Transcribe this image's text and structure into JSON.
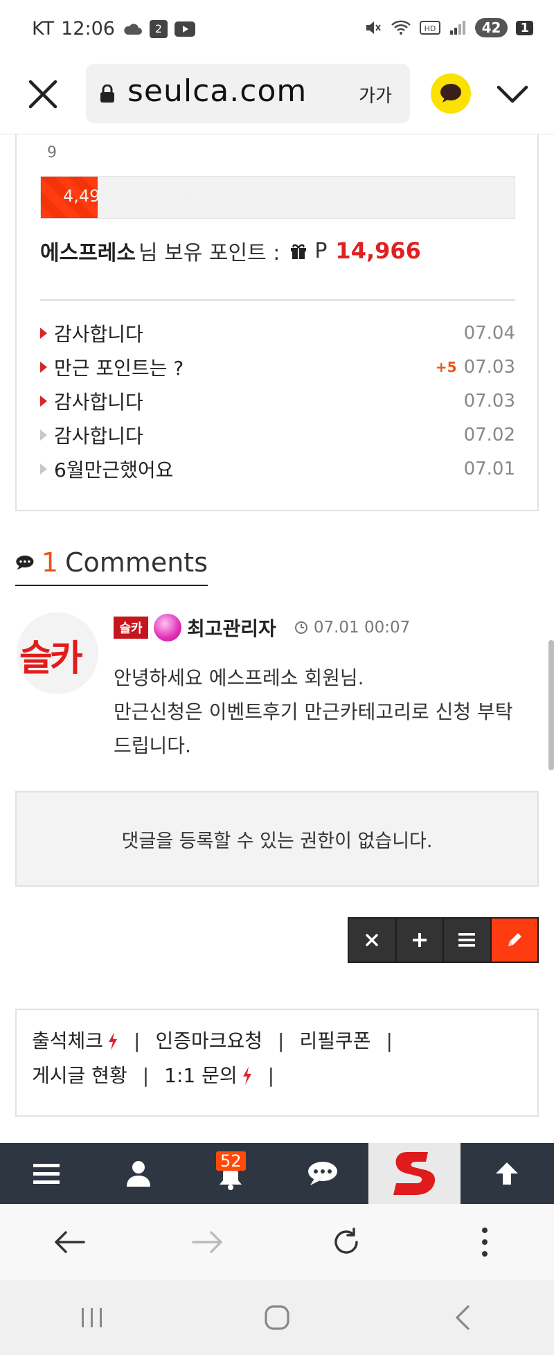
{
  "status_bar": {
    "carrier": "KT",
    "time": "12:06",
    "battery": "42",
    "notification_count": "1"
  },
  "browser": {
    "url": "seulca.com",
    "text_size_label": "가가"
  },
  "profile": {
    "level": "9",
    "exp_text": "4,496,857 (12%)",
    "exp_fraction": 0.12,
    "username": "에스프레소",
    "points_label": "님 보유 포인트 :",
    "points_prefix": "P",
    "points_value": "14,966"
  },
  "posts": [
    {
      "title": "감사합니다",
      "date": "07.04",
      "plus": "",
      "active": true
    },
    {
      "title": "만근 포인트는 ?",
      "date": "07.03",
      "plus": "+5",
      "active": true
    },
    {
      "title": "감사합니다",
      "date": "07.03",
      "plus": "",
      "active": true
    },
    {
      "title": "감사합니다",
      "date": "07.02",
      "plus": "",
      "active": false
    },
    {
      "title": "6월만근했어요",
      "date": "07.01",
      "plus": "",
      "active": false
    }
  ],
  "comments": {
    "count": "1",
    "label": "Comments",
    "items": [
      {
        "avatar_text": "슬카",
        "level_badge": "슬카",
        "author": "최고관리자",
        "time": "07.01 00:07",
        "lines": [
          "안녕하세요 에스프레소 회원님.",
          "만근신청은 이벤트후기 만근카테고리로 신청 부탁",
          "드립니다."
        ]
      }
    ]
  },
  "no_permission_text": "댓글을 등록할 수 있는 권한이 없습니다.",
  "quick_links": {
    "row1": [
      "출석체크",
      "인증마크요청",
      "리필쿠폰"
    ],
    "row2": [
      "게시글 현황",
      "1:1 문의"
    ]
  },
  "site_nav": {
    "alarm_count": "52"
  },
  "colors": {
    "accent": "#ff3b10",
    "points_red": "#e02020",
    "nav_bg": "#2e3641"
  }
}
